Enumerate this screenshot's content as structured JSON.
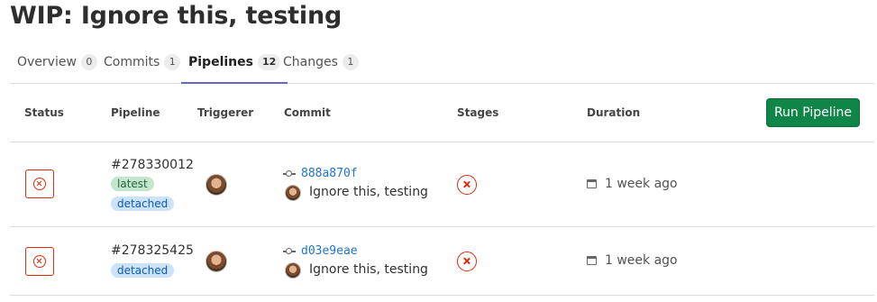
{
  "page": {
    "title": "WIP: Ignore this, testing"
  },
  "tabs": [
    {
      "label": "Overview",
      "count": "0"
    },
    {
      "label": "Commits",
      "count": "1"
    },
    {
      "label": "Pipelines",
      "count": "12"
    },
    {
      "label": "Changes",
      "count": "1"
    }
  ],
  "active_tab": "Pipelines",
  "table": {
    "headers": {
      "status": "Status",
      "pipeline": "Pipeline",
      "triggerer": "Triggerer",
      "commit": "Commit",
      "stages": "Stages",
      "duration": "Duration"
    },
    "run_button": "Run Pipeline",
    "rows": [
      {
        "status": "failed",
        "pipeline_id": "#278330012",
        "badges": [
          "latest",
          "detached"
        ],
        "commit_sha": "888a870f",
        "commit_title": "Ignore this, testing",
        "stage_status": "failed",
        "finished": "1 week ago"
      },
      {
        "status": "failed",
        "pipeline_id": "#278325425",
        "badges": [
          "detached"
        ],
        "commit_sha": "d03e9eae",
        "commit_title": "Ignore this, testing",
        "stage_status": "failed",
        "finished": "1 week ago"
      }
    ]
  },
  "icons": {
    "status_failed": "status-failed-icon",
    "stage_failed": "stage-failed-icon",
    "commit": "commit-icon",
    "calendar": "calendar-icon"
  },
  "colors": {
    "accent": "#6666c4",
    "primary_button": "#108548",
    "failed": "#dd2b0e",
    "link": "#1f75cb"
  }
}
